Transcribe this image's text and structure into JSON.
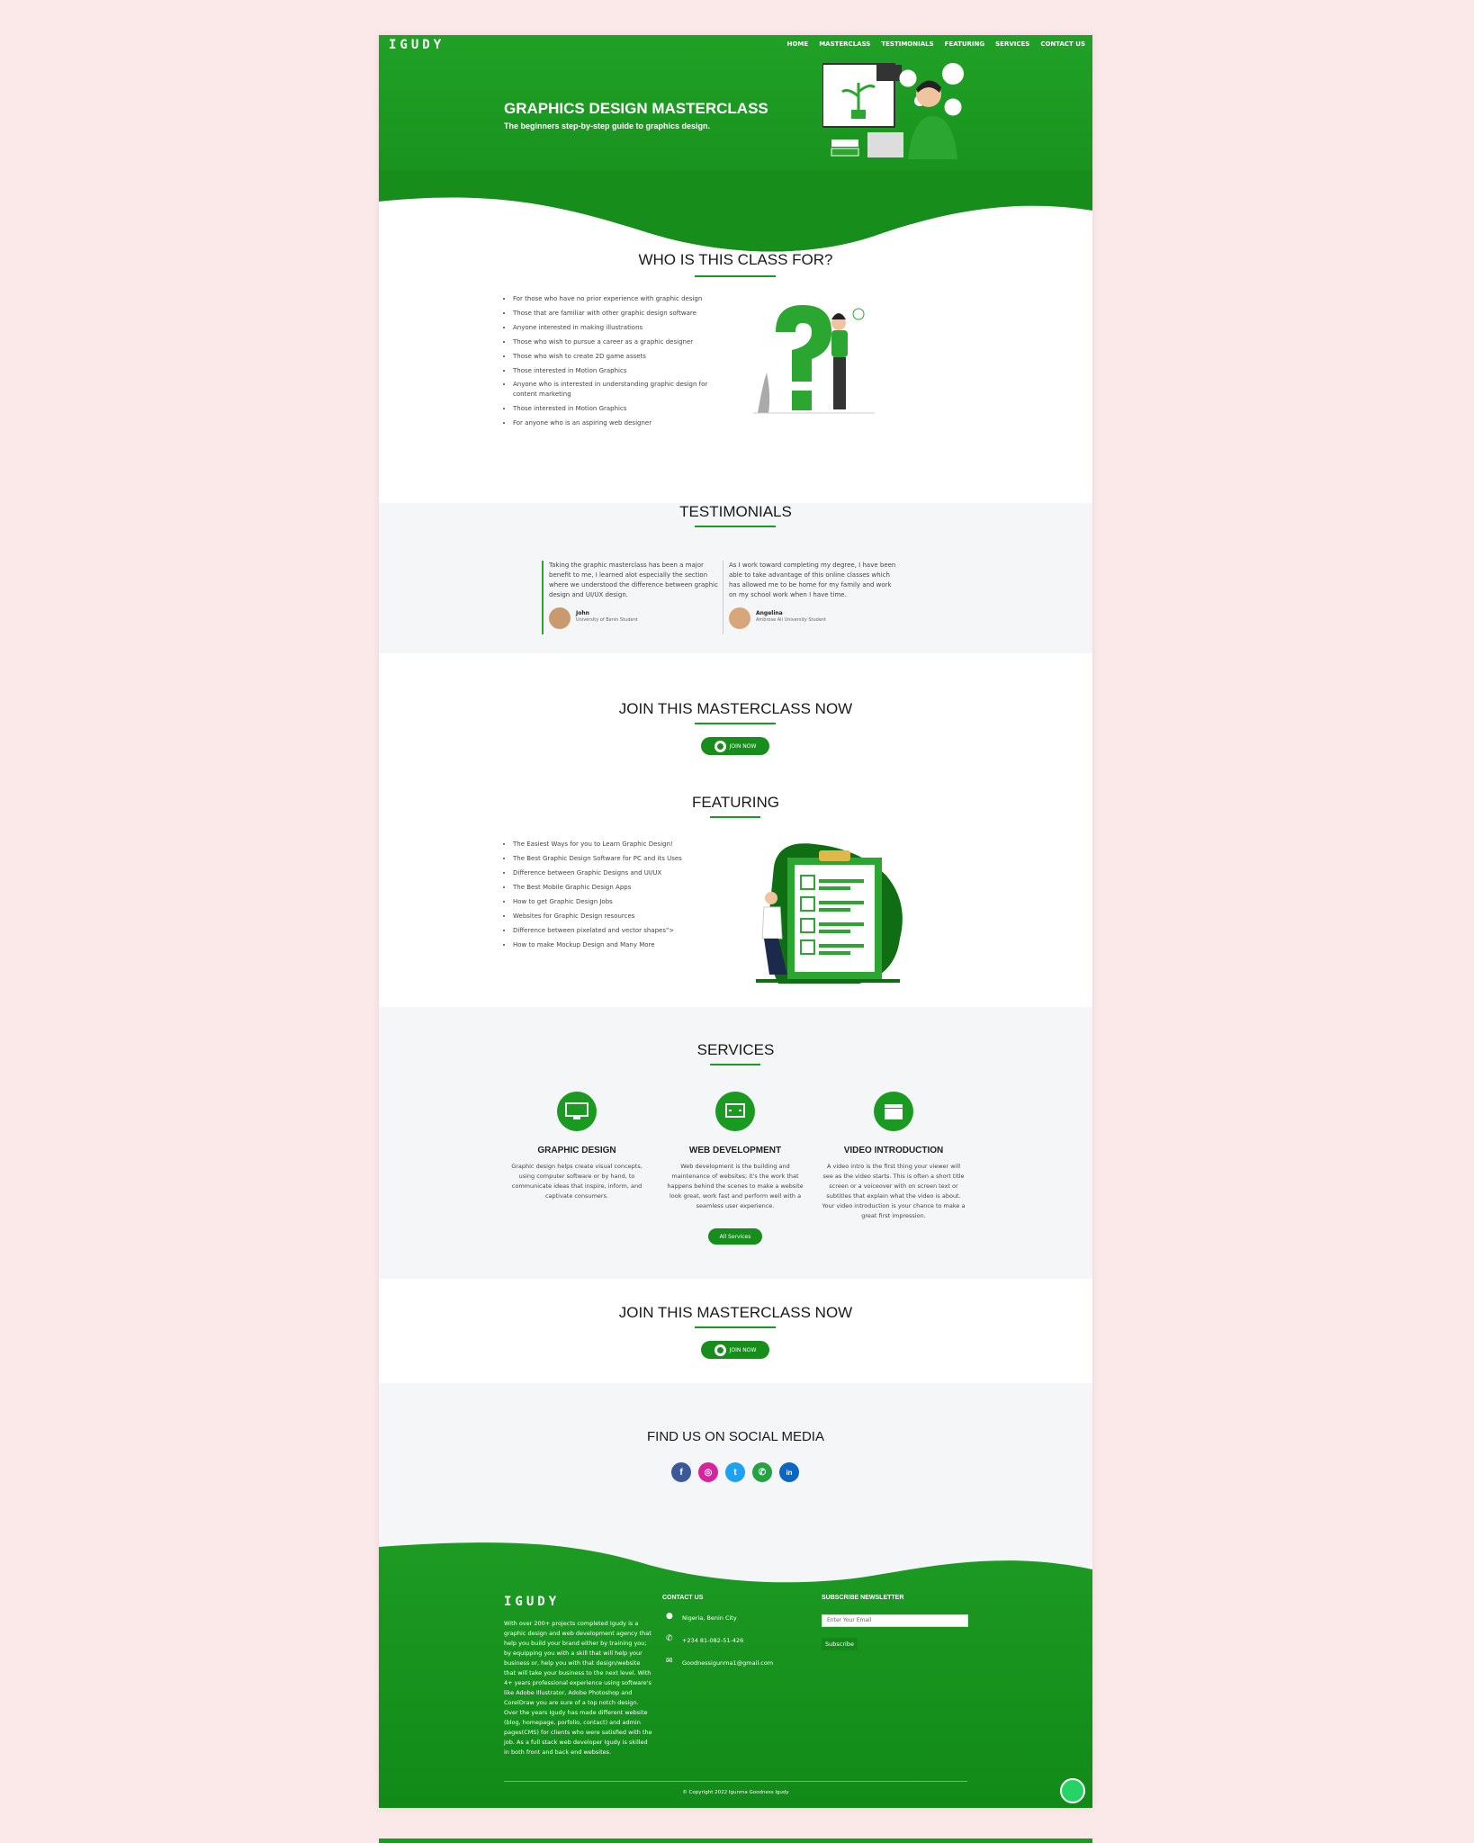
{
  "brand": "IGUDY",
  "nav": [
    "HOME",
    "MASTERCLASS",
    "TESTIMONIALS",
    "FEATURING",
    "SERVICES",
    "CONTACT US"
  ],
  "hero": {
    "title": "GRAPHICS DESIGN MASTERCLASS",
    "subtitle": "The beginners step-by-step guide to graphics design."
  },
  "who": {
    "title": "WHO IS THIS CLASS FOR?",
    "items": [
      "For those who have no prior experience with graphic design",
      "Those that are familiar with other graphic design software",
      "Anyone interested in making illustrations",
      "Those who wish to pursue a career as a graphic designer",
      "Those who wish to create 2D game assets",
      "Those interested in Motion Graphics",
      "Anyone who is interested in understanding graphic design for content marketing",
      "Those interested in Motion Graphics",
      "For anyone who is an aspiring web designer"
    ]
  },
  "testimonials": {
    "title": "TESTIMONIALS",
    "items": [
      {
        "text": "Taking the graphic masterclass has been a major benefit to me, I learned alot especially the section where we understood the difference between graphic design and UI/UX design.",
        "name": "John",
        "role": "University of Benin Student"
      },
      {
        "text": "As I work toward completing my degree, I have been able to take advantage of this online classes which has allowed me to be home for my family and work on my school work when I have time.",
        "name": "Angelina",
        "role": "Ambrose Ali University Student"
      }
    ]
  },
  "join1": {
    "title": "JOIN THIS MASTERCLASS NOW",
    "button": "JOIN NOW"
  },
  "featuring": {
    "title": "FEATURING",
    "items": [
      "The Easiest Ways for you to Learn Graphic Design!",
      "The Best Graphic Design Software for PC and its Uses",
      "Difference between Graphic Designs and UI/UX",
      "The Best Mobile Graphic Design Apps",
      "How to get Graphic Design Jobs",
      "Websites for Graphic Design resources",
      "Difference between pixelated and vector shapes\">",
      "How to make Mockup Design and Many More"
    ]
  },
  "services": {
    "title": "SERVICES",
    "items": [
      {
        "icon": "monitor-icon",
        "title": "GRAPHIC DESIGN",
        "text": "Graphic design helps create visual concepts, using computer software or by hand, to communicate ideas that inspire, inform, and captivate consumers."
      },
      {
        "icon": "web-icon",
        "title": "WEB DEVELOPMENT",
        "text": "Web development is the building and maintenance of websites; it's the work that happens behind the scenes to make a website look great, work fast and perform well with a seamless user experience."
      },
      {
        "icon": "clapperboard-icon",
        "title": "VIDEO INTRODUCTION",
        "text": "A video intro is the first thing your viewer will see as the video starts. This is often a short title screen or a voiceover with on screen text or subtitles that explain what the video is about. Your video introduction is your chance to make a great first impression."
      }
    ],
    "button": "All Services"
  },
  "join2": {
    "title": "JOIN THIS MASTERCLASS NOW",
    "button": "JOIN NOW"
  },
  "social": {
    "title": "FIND US ON SOCIAL MEDIA",
    "items": [
      {
        "icon": "facebook-icon",
        "glyph": "f",
        "color": "#3b5998"
      },
      {
        "icon": "instagram-icon",
        "glyph": "◎",
        "color": "#d6249f"
      },
      {
        "icon": "twitter-icon",
        "glyph": "t",
        "color": "#1da1f2"
      },
      {
        "icon": "whatsapp-icon",
        "glyph": "✆",
        "color": "#25a244"
      },
      {
        "icon": "linkedin-icon",
        "glyph": "in",
        "color": "#0a66c2"
      }
    ]
  },
  "footer": {
    "about": "With over 200+ projects completed Igudy is a graphic design and web development agency that help you build your brand either by training you; by equipping you with a skill that will help your business or, help you with that design/website that will take your business to the next level. With 4+ years professional experience using software's like Adobe Illustrator, Adobe Photoshop and CorelDraw you are sure of a top notch design. Over the years Igudy has made different website (blog, homepage, porfolio, contact) and admin pages(CMS) for clients who were satisfied with the job. As a full stack web developer Igudy is skilled in both front and back end websites.",
    "contact_title": "CONTACT US",
    "location": "Nigeria, Benin City",
    "phone": "+234 81-082-51-426",
    "email": "Goodnessigunma1@gmail.com",
    "newsletter_title": "SUBSCRIBE NEWSLETTER",
    "email_placeholder": "Enter Your Email",
    "subscribe": "Subscribe",
    "copyright": "© Copyright 2022 Igunma Goodness Igudy"
  }
}
